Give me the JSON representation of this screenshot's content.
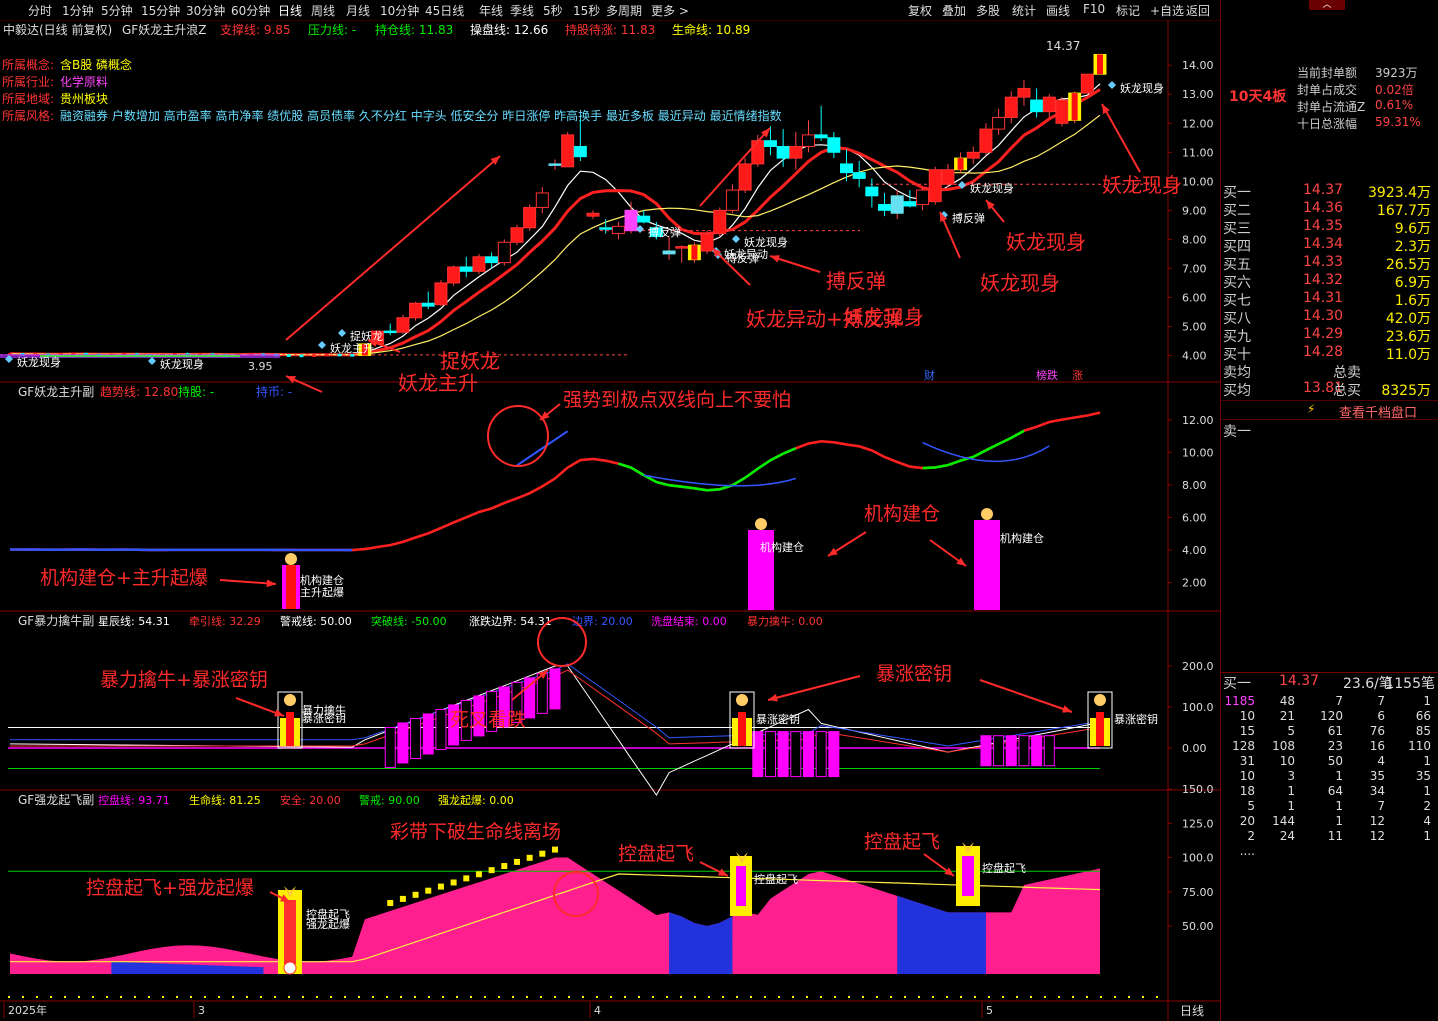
{
  "toolbar": {
    "periods": [
      "分时",
      "1分钟",
      "5分钟",
      "15分钟",
      "30分钟",
      "60分钟",
      "日线",
      "周线",
      "月线",
      "10分钟",
      "45日线",
      "年线",
      "季线",
      "5秒",
      "15秒",
      "多周期",
      "更多 >"
    ],
    "right_buttons": [
      "复权",
      "叠加",
      "多股",
      "统计",
      "画线",
      "F10",
      "标记",
      "+自选",
      "返回"
    ],
    "active_period": "日线"
  },
  "main_panel": {
    "stock_name": "中毅达(日线 前复权)",
    "indicator_name": "GF妖龙主升浪Z",
    "indicator_values": [
      {
        "label": "支撑线:",
        "value": "9.85",
        "color": "#ff3333"
      },
      {
        "label": "压力线:",
        "value": "-",
        "color": "#00ee00"
      },
      {
        "label": "持仓线:",
        "value": "11.83",
        "color": "#00ee00"
      },
      {
        "label": "操盘线:",
        "value": "12.66",
        "color": "#ffffff"
      },
      {
        "label": "持股待涨:",
        "value": "11.83",
        "color": "#ff3333"
      },
      {
        "label": "生命线:",
        "value": "10.89",
        "color": "#ffff00"
      }
    ],
    "info": [
      {
        "label": "所属概念:",
        "value": "含B股  磷概念"
      },
      {
        "label": "所属行业:",
        "value": "化学原料"
      },
      {
        "label": "所属地域:",
        "value": "贵州板块"
      },
      {
        "label": "所属风格:",
        "value": "融资融券 户数增加 高市盈率 高市净率 绩优股 高员债率 久不分红 中字头 低安全分 昨日涨停 昨高换手 最近多板 最近异动 最近情绪指数"
      }
    ],
    "y_ticks": [
      "14.00",
      "13.00",
      "12.00",
      "11.00",
      "10.00",
      "9.00",
      "8.00",
      "7.00",
      "6.00",
      "5.00",
      "4.00"
    ],
    "price_high_label": "14.37",
    "price_low_label": "3.95",
    "chart_signals": [
      "妖龙现身",
      "妖龙现身",
      "捉妖龙",
      "妖龙主升",
      "搏反弹",
      "妖龙现身",
      "妖龙异动",
      "搏反弹",
      "妖龙现身",
      "搏反弹",
      "妖龙现身"
    ],
    "bottom_badges": [
      "财",
      "榜跌",
      "涨"
    ],
    "annotations": [
      "捉妖龙",
      "妖龙主升",
      "妖龙现身",
      "妖龙现身",
      "妖龙异动+搏反弹",
      "搏反弹",
      "妖龙现身",
      "妖龙现身"
    ]
  },
  "panel2": {
    "title": "GF妖龙主升副",
    "values": [
      {
        "label": "趋势线:",
        "value": "12.80",
        "color": "#ff3333"
      },
      {
        "label": "持股:",
        "value": "-",
        "color": "#00ee00"
      },
      {
        "label": "持币:",
        "value": "-",
        "color": "#3355ff"
      }
    ],
    "y_ticks": [
      "12.00",
      "10.00",
      "8.00",
      "6.00",
      "4.00",
      "2.00"
    ],
    "chart_labels": [
      "机构建仓",
      "主升起爆",
      "机构建仓",
      "机构建仓"
    ],
    "annotations": [
      "强势到极点双线向上不要怕",
      "机构建仓",
      "机构建仓+主升起爆"
    ]
  },
  "panel3": {
    "title": "GF暴力擒牛副",
    "values": [
      {
        "label": "星辰线:",
        "value": "54.31",
        "color": "#ffffff"
      },
      {
        "label": "牵引线:",
        "value": "32.29",
        "color": "#ff3333"
      },
      {
        "label": "警戒线:",
        "value": "50.00",
        "color": "#ffffff"
      },
      {
        "label": "突破线:",
        "value": "-50.00",
        "color": "#00ee00"
      },
      {
        "label": "涨跌边界:",
        "value": "54.31",
        "color": "#ffffff"
      },
      {
        "label": "边界:",
        "value": "20.00",
        "color": "#3355ff"
      },
      {
        "label": "洗盘结束:",
        "value": "0.00",
        "color": "#ff00ff"
      },
      {
        "label": "暴力擒牛:",
        "value": "0.00",
        "color": "#ff3333"
      }
    ],
    "y_ticks": [
      "200.0",
      "100.0",
      "0.00"
    ],
    "chart_labels": [
      "暴力擒牛",
      "暴涨密钥",
      "暴涨密钥",
      "暴涨密钥"
    ],
    "annotations": [
      "暴力擒牛+暴涨密钥",
      "死叉看跌",
      "暴涨密钥"
    ]
  },
  "panel4": {
    "title": "GF强龙起飞副",
    "values": [
      {
        "label": "控盘线:",
        "value": "93.71",
        "color": "#ff00ff"
      },
      {
        "label": "生命线:",
        "value": "81.25",
        "color": "#ffff00"
      },
      {
        "label": "安全:",
        "value": "20.00",
        "color": "#ff3333"
      },
      {
        "label": "警戒:",
        "value": "90.00",
        "color": "#00ee00"
      },
      {
        "label": "强龙起爆:",
        "value": "0.00",
        "color": "#ffff00"
      }
    ],
    "y_ticks": [
      "150.0",
      "125.0",
      "100.0",
      "75.00",
      "50.00"
    ],
    "chart_labels": [
      "控盘起飞",
      "强龙起爆",
      "控盘起飞",
      "控盘起飞"
    ],
    "annotations": [
      "彩带下破生命线离场",
      "控盘起飞",
      "控盘起飞",
      "控盘起飞+强龙起爆"
    ]
  },
  "x_axis": {
    "labels": [
      "2025年",
      "3",
      "4",
      "5"
    ],
    "period_label": "日线"
  },
  "right_panel": {
    "board_label": "10天4板",
    "stats": [
      {
        "label": "当前封单额",
        "value": "3923万"
      },
      {
        "label": "封单占成交",
        "value": "0.02倍"
      },
      {
        "label": "封单占流通Z",
        "value": "0.61%"
      },
      {
        "label": "十日总涨幅",
        "value": "59.31%"
      }
    ],
    "bids": [
      {
        "label": "买一",
        "price": "14.37",
        "vol": "3923.4万"
      },
      {
        "label": "买二",
        "price": "14.36",
        "vol": "167.7万"
      },
      {
        "label": "买三",
        "price": "14.35",
        "vol": "9.6万"
      },
      {
        "label": "买四",
        "price": "14.34",
        "vol": "2.3万"
      },
      {
        "label": "买五",
        "price": "14.33",
        "vol": "26.5万"
      },
      {
        "label": "买六",
        "price": "14.32",
        "vol": "6.9万"
      },
      {
        "label": "买七",
        "price": "14.31",
        "vol": "1.6万"
      },
      {
        "label": "买八",
        "price": "14.30",
        "vol": "42.0万"
      },
      {
        "label": "买九",
        "price": "14.29",
        "vol": "23.6万"
      },
      {
        "label": "买十",
        "price": "14.28",
        "vol": "11.0万"
      }
    ],
    "avg_rows": [
      {
        "l1": "卖均",
        "v1": "",
        "l2": "总卖",
        "v2": ""
      },
      {
        "l1": "买均",
        "v1": "13.81",
        "l2": "总买",
        "v2": "8325万"
      }
    ],
    "view_button": "查看千档盘口",
    "sell_one": "卖一",
    "trade_header": {
      "label": "买一",
      "price": "14.37",
      "per": "23.6/笔",
      "vol": "1155笔"
    },
    "trade_rows": [
      [
        "1185",
        "48",
        "7",
        "7",
        "1"
      ],
      [
        "10",
        "21",
        "120",
        "6",
        "66"
      ],
      [
        "15",
        "5",
        "61",
        "76",
        "85"
      ],
      [
        "128",
        "108",
        "23",
        "16",
        "110"
      ],
      [
        "31",
        "10",
        "50",
        "4",
        "1"
      ],
      [
        "10",
        "3",
        "1",
        "35",
        "35"
      ],
      [
        "18",
        "1",
        "64",
        "34",
        "1"
      ],
      [
        "5",
        "1",
        "1",
        "7",
        "2"
      ],
      [
        "20",
        "144",
        "1",
        "12",
        "4"
      ],
      [
        "2",
        "24",
        "11",
        "12",
        "1"
      ],
      [
        "....",
        "",
        "",
        "",
        ""
      ]
    ]
  },
  "chart_data": {
    "type": "candlestick",
    "title": "中毅达(日线 前复权)",
    "x_labels": [
      "2025年",
      "3",
      "4",
      "5"
    ],
    "ylim": [
      3.5,
      14.8
    ],
    "candles": [
      [
        4.05,
        4.08,
        4.0,
        4.06
      ],
      [
        4.06,
        4.09,
        4.02,
        4.04
      ],
      [
        4.04,
        4.07,
        4.0,
        4.05
      ],
      [
        4.05,
        4.08,
        4.01,
        4.03
      ],
      [
        4.03,
        4.06,
        3.99,
        4.05
      ],
      [
        4.05,
        4.09,
        4.02,
        4.07
      ],
      [
        4.07,
        4.1,
        4.03,
        4.04
      ],
      [
        4.04,
        4.06,
        3.98,
        4.02
      ],
      [
        4.02,
        4.05,
        3.97,
        4.04
      ],
      [
        4.04,
        4.08,
        4.01,
        4.06
      ],
      [
        4.06,
        4.09,
        4.02,
        4.03
      ],
      [
        4.03,
        4.05,
        3.96,
        4.0
      ],
      [
        4.0,
        4.04,
        3.95,
        4.03
      ],
      [
        4.03,
        4.07,
        4.0,
        4.06
      ],
      [
        4.06,
        4.1,
        4.02,
        4.04
      ],
      [
        4.04,
        4.07,
        4.0,
        4.05
      ],
      [
        4.05,
        4.09,
        4.01,
        4.02
      ],
      [
        4.02,
        4.05,
        3.97,
        4.01
      ],
      [
        4.01,
        4.04,
        3.96,
        4.03
      ],
      [
        4.03,
        4.06,
        3.99,
        4.05
      ],
      [
        4.05,
        4.08,
        4.0,
        4.04
      ],
      [
        4.04,
        4.07,
        3.98,
        4.02
      ],
      [
        4.02,
        4.05,
        3.96,
        4.01
      ],
      [
        4.01,
        4.03,
        3.95,
        4.0
      ],
      [
        4.0,
        4.03,
        3.95,
        4.02
      ],
      [
        4.02,
        4.05,
        3.98,
        4.04
      ],
      [
        4.04,
        4.06,
        4.0,
        4.03
      ],
      [
        4.03,
        4.05,
        3.97,
        4.0
      ],
      [
        4.0,
        4.42,
        4.0,
        4.4
      ],
      [
        4.4,
        4.84,
        4.4,
        4.84
      ],
      [
        4.84,
        5.1,
        4.7,
        4.8
      ],
      [
        4.8,
        5.4,
        4.75,
        5.3
      ],
      [
        5.3,
        5.85,
        5.2,
        5.8
      ],
      [
        5.8,
        6.2,
        5.6,
        5.7
      ],
      [
        5.75,
        6.6,
        5.7,
        6.5
      ],
      [
        6.5,
        7.1,
        6.4,
        7.05
      ],
      [
        7.05,
        7.4,
        6.7,
        6.9
      ],
      [
        6.9,
        7.5,
        6.8,
        7.4
      ],
      [
        7.4,
        7.55,
        7.0,
        7.2
      ],
      [
        7.2,
        8.0,
        7.1,
        7.9
      ],
      [
        7.9,
        8.5,
        7.8,
        8.4
      ],
      [
        8.4,
        9.2,
        8.3,
        9.1
      ],
      [
        9.1,
        9.8,
        8.9,
        9.6
      ],
      [
        10.6,
        10.75,
        10.4,
        10.6
      ],
      [
        10.5,
        11.7,
        11.0,
        11.6
      ],
      [
        11.2,
        12.1,
        10.7,
        10.85
      ],
      [
        8.8,
        9.0,
        8.7,
        8.9
      ],
      [
        8.4,
        8.7,
        8.2,
        8.35
      ],
      [
        8.2,
        8.6,
        8.0,
        8.45
      ],
      [
        8.3,
        9.3,
        8.2,
        9.0
      ],
      [
        8.8,
        9.0,
        8.55,
        8.6
      ],
      [
        8.4,
        8.6,
        8.0,
        8.1
      ],
      [
        7.5,
        8.1,
        7.3,
        7.6
      ],
      [
        7.7,
        7.8,
        7.2,
        7.75
      ],
      [
        7.3,
        7.9,
        7.2,
        7.8
      ],
      [
        7.6,
        8.3,
        7.5,
        8.2
      ],
      [
        8.2,
        9.1,
        8.1,
        9.0
      ],
      [
        9.0,
        9.9,
        8.9,
        9.7
      ],
      [
        9.7,
        10.8,
        9.6,
        10.6
      ],
      [
        10.6,
        11.6,
        10.5,
        11.4
      ],
      [
        11.4,
        11.9,
        10.9,
        11.2
      ],
      [
        11.2,
        11.8,
        10.5,
        10.8
      ],
      [
        10.8,
        11.7,
        10.4,
        11.2
      ],
      [
        11.2,
        12.1,
        11.0,
        11.6
      ],
      [
        11.6,
        12.6,
        11.4,
        11.5
      ],
      [
        11.5,
        11.7,
        10.8,
        11.0
      ],
      [
        10.6,
        11.1,
        10.0,
        10.3
      ],
      [
        10.3,
        10.7,
        9.8,
        10.1
      ],
      [
        9.8,
        10.1,
        9.1,
        9.5
      ],
      [
        9.2,
        9.6,
        8.8,
        9.0
      ],
      [
        8.9,
        9.7,
        8.7,
        9.5
      ],
      [
        9.3,
        9.7,
        9.1,
        9.15
      ],
      [
        9.2,
        9.8,
        9.0,
        9.7
      ],
      [
        9.3,
        10.5,
        9.2,
        10.4
      ],
      [
        9.9,
        10.6,
        9.8,
        10.4
      ],
      [
        10.4,
        11.0,
        10.3,
        10.8
      ],
      [
        10.8,
        11.2,
        10.6,
        11.0
      ],
      [
        11.0,
        12.0,
        10.9,
        11.8
      ],
      [
        11.8,
        12.5,
        11.6,
        12.2
      ],
      [
        12.2,
        13.1,
        12.0,
        12.9
      ],
      [
        12.9,
        13.5,
        12.6,
        13.2
      ],
      [
        12.8,
        13.2,
        12.2,
        12.4
      ],
      [
        12.4,
        13.0,
        12.2,
        12.9
      ],
      [
        12.0,
        12.9,
        11.9,
        12.8
      ],
      [
        12.1,
        13.1,
        12.0,
        13.04
      ],
      [
        13.04,
        13.69,
        13.04,
        13.69
      ],
      [
        13.69,
        14.37,
        13.69,
        14.37
      ]
    ]
  }
}
